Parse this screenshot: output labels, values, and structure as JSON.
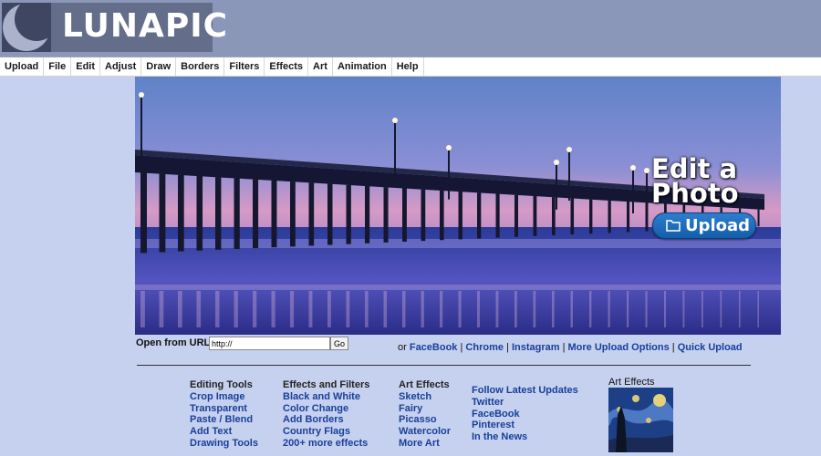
{
  "header": {
    "logo_text": "LUNAPIC"
  },
  "menu": [
    "Upload",
    "File",
    "Edit",
    "Adjust",
    "Draw",
    "Borders",
    "Filters",
    "Effects",
    "Art",
    "Animation",
    "Help"
  ],
  "hero": {
    "title_line1": "Edit a",
    "title_line2": "Photo",
    "upload_label": "Upload"
  },
  "url": {
    "label": "Open from URL:",
    "value": "http://",
    "go_label": "Go"
  },
  "links": {
    "prefix": "or ",
    "sep": " | ",
    "items": [
      "FaceBook",
      "Chrome",
      "Instagram",
      "More Upload Options",
      "Quick Upload"
    ]
  },
  "columns": [
    {
      "heading": "Editing Tools",
      "links": [
        "Crop Image",
        "Transparent",
        "Paste / Blend",
        "Add Text",
        "Drawing Tools"
      ]
    },
    {
      "heading": "Effects and Filters",
      "links": [
        "Black and White",
        "Color Change",
        "Add Borders",
        "Country Flags",
        "200+ more effects"
      ]
    },
    {
      "heading": "Art Effects",
      "links": [
        "Sketch",
        "Fairy",
        "Picasso",
        "Watercolor",
        "More Art"
      ]
    },
    {
      "heading": "",
      "links": [
        "Follow Latest Updates",
        "Twitter",
        "FaceBook",
        "Pinterest",
        "In the News"
      ]
    }
  ],
  "art_panel": {
    "label": "Art Effects"
  },
  "colors": {
    "header_bg": "#8b97b9",
    "page_bg": "#c5d1ee",
    "link": "#1a3f9a",
    "upload_button": "#1e6cbf"
  }
}
